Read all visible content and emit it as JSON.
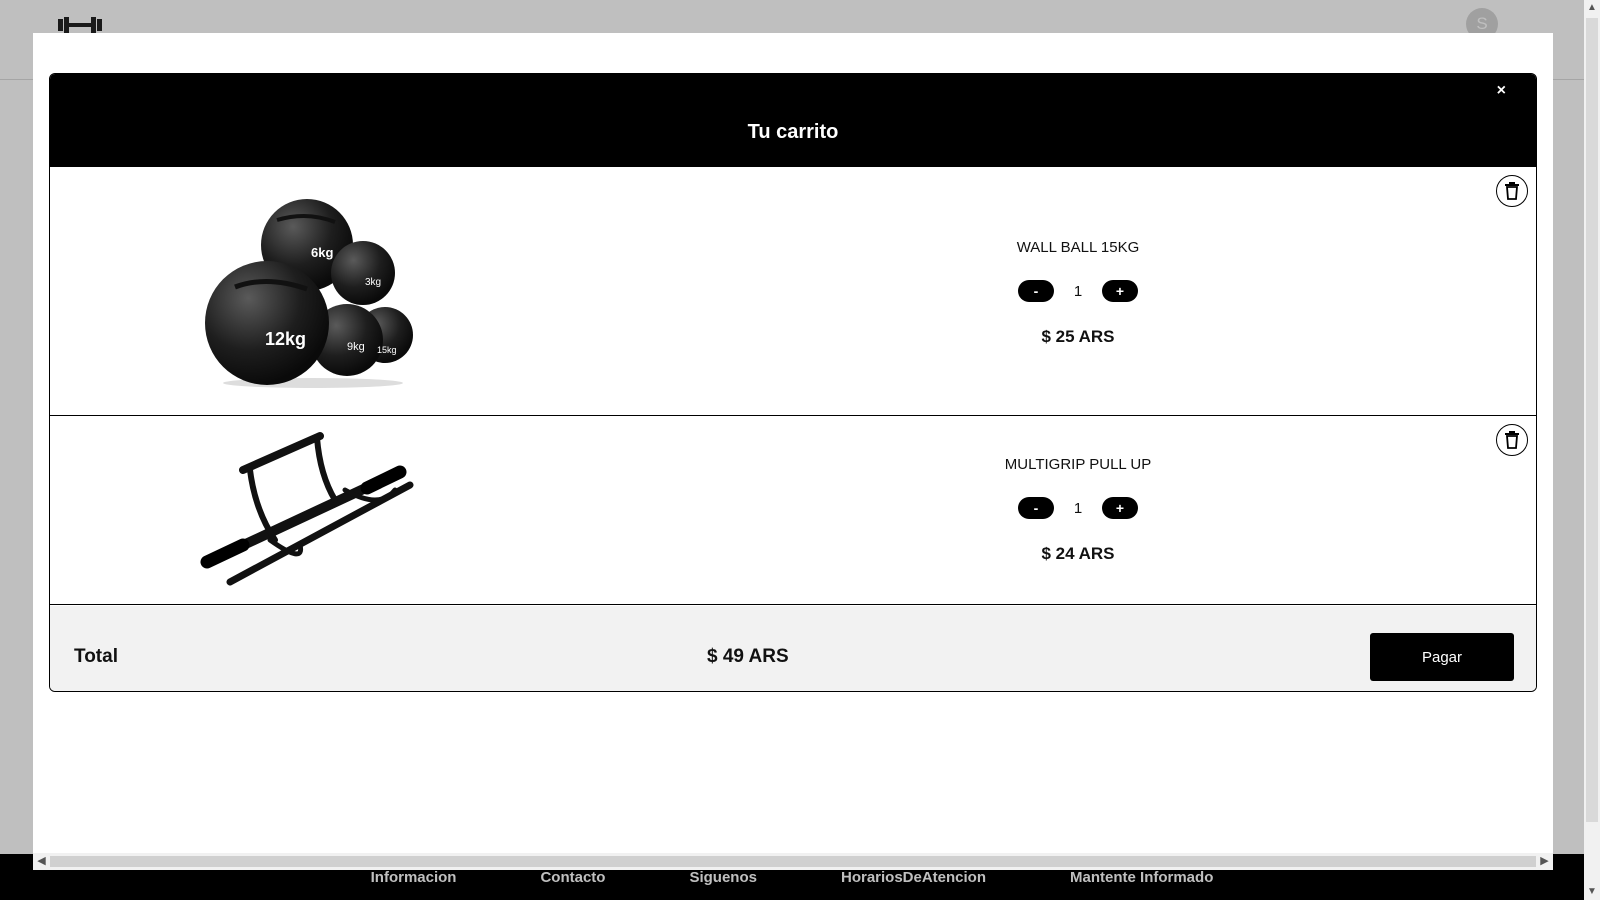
{
  "header": {
    "avatar_initial": "S"
  },
  "footer": {
    "links": [
      "Informacion",
      "Contacto",
      "Siguenos",
      "HorariosDeAtencion",
      "Mantente Informado"
    ]
  },
  "cart": {
    "title": "Tu carrito",
    "close_label": "×",
    "items": [
      {
        "name": "WALL BALL 15KG",
        "quantity": "1",
        "minus_label": "-",
        "plus_label": "+",
        "price": "$ 25 ARS",
        "image": "wall-ball-image"
      },
      {
        "name": "MULTIGRIP PULL UP",
        "quantity": "1",
        "minus_label": "-",
        "plus_label": "+",
        "price": "$ 24 ARS",
        "image": "pull-up-bar-image"
      }
    ],
    "total_label": "Total",
    "total_value": "$ 49 ARS",
    "pay_label": "Pagar"
  },
  "colors": {
    "primary": "#000000",
    "footer_bg": "#f2f2f2",
    "backdrop": "rgba(0,0,0,0.25)"
  }
}
